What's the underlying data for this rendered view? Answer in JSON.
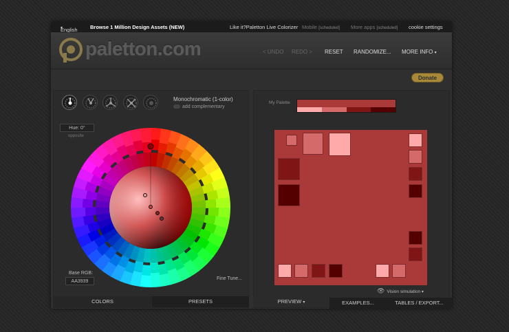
{
  "topbar": {
    "language": "English",
    "language_arrow": "▾",
    "browse": "Browse 1 Million Design Assets (NEW)",
    "like": "Like it?",
    "live_colorizer": "Paletton Live Colorizer",
    "mobile": "Mobile",
    "mobile_tag": "[scheduled]",
    "more_apps": "More apps",
    "more_apps_tag": "[scheduled]",
    "cookie": "cookie settings"
  },
  "header": {
    "logo_text": "paletton.com",
    "undo": "< UNDO",
    "redo": "REDO >",
    "reset": "RESET",
    "randomize": "RANDOMIZE...",
    "more_info": "MORE INFO",
    "more_info_arrow": "▾"
  },
  "donate": "Donate",
  "scheme": {
    "name": "Monochromatic (1-color)",
    "add_complementary": "add complementary"
  },
  "hue": {
    "label": "Hue: 0°",
    "opposite": "opposite"
  },
  "base_rgb": {
    "label": "Base RGB:",
    "value": "AA3939"
  },
  "fine_tune": "Fine Tune...",
  "my_palette": {
    "label": "My Palette",
    "main": "#AA3939",
    "shades": [
      "#FFAAAA",
      "#D46A6A",
      "#801515",
      "#550000"
    ]
  },
  "vision": {
    "label": "Vision simulation",
    "arrow": "▾"
  },
  "tabs": {
    "colors": "COLORS",
    "presets": "PRESETS",
    "preview": "PREVIEW",
    "preview_arrow": "▾",
    "examples": "EXAMPLES...",
    "tables": "TABLES / EXPORT..."
  },
  "colors": {
    "base": "#AA3939",
    "lightest": "#FFAAAA",
    "light": "#D46A6A",
    "dark": "#801515",
    "darkest": "#550000",
    "donate": "#A8893A"
  }
}
